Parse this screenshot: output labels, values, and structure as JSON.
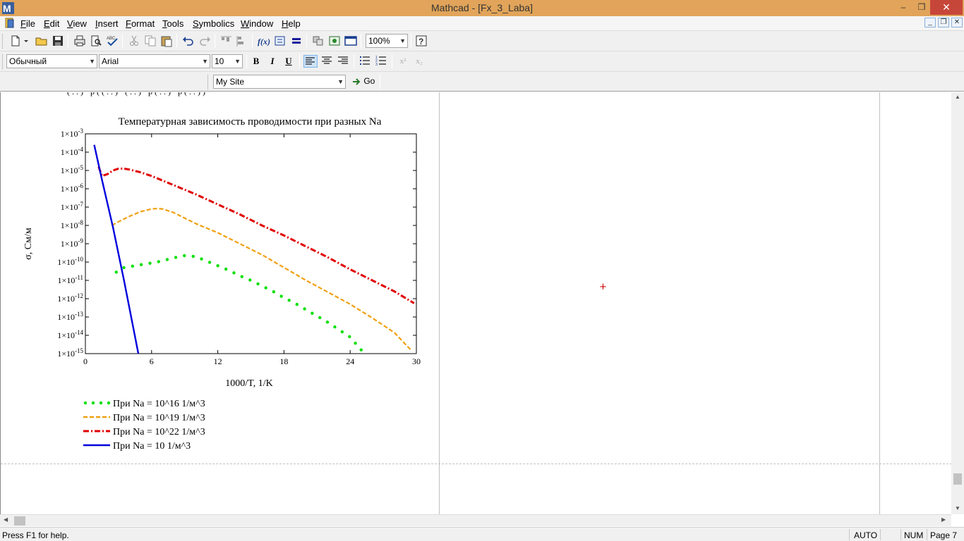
{
  "window": {
    "title": "Mathcad - [Fx_3_Laba]",
    "minimize_label": "–",
    "restore_label": "❐",
    "close_label": "✕"
  },
  "menu": {
    "items": [
      {
        "label": "File",
        "accel": "F",
        "rest": "ile"
      },
      {
        "label": "Edit",
        "accel": "E",
        "rest": "dit"
      },
      {
        "label": "View",
        "accel": "V",
        "rest": "iew"
      },
      {
        "label": "Insert",
        "accel": "I",
        "rest": "nsert"
      },
      {
        "label": "Format",
        "accel": "F",
        "rest": "ormat"
      },
      {
        "label": "Tools",
        "accel": "T",
        "rest": "ools"
      },
      {
        "label": "Symbolics",
        "accel": "S",
        "rest": "ymbolics"
      },
      {
        "label": "Window",
        "accel": "W",
        "rest": "indow"
      },
      {
        "label": "Help",
        "accel": "H",
        "rest": "elp"
      }
    ]
  },
  "toolbar": {
    "zoom_value": "100%",
    "style_value": "Обычный",
    "font_value": "Arial",
    "size_value": "10",
    "bold_label": "B",
    "italic_label": "I",
    "underline_label": "U",
    "site_value": "My Site",
    "go_label": "Go"
  },
  "status": {
    "help_text": "Press F1 for help.",
    "mode": "AUTO",
    "numlock": "NUM",
    "page": "Page 7"
  },
  "colors": {
    "titlebar": "#e1a45a",
    "close_button": "#c7463a",
    "series_16": "#00e000",
    "series_19": "#f0a010",
    "series_22": "#e00000",
    "series_10": "#0000dd"
  },
  "chart_data": {
    "type": "line",
    "title": "Температурная зависимость проводимости при разных Na",
    "xlabel": "1000/T, 1/K",
    "ylabel": "σ, См/м",
    "xlim": [
      0,
      30
    ],
    "ylim_exp": [
      -15,
      -3
    ],
    "yscale": "log",
    "x_ticks": [
      "0",
      "6",
      "12",
      "18",
      "24",
      "30"
    ],
    "y_ticks": [
      {
        "base": "1×10",
        "exp": "-3"
      },
      {
        "base": "1×10",
        "exp": "-4"
      },
      {
        "base": "1×10",
        "exp": "-5"
      },
      {
        "base": "1×10",
        "exp": "-6"
      },
      {
        "base": "1×10",
        "exp": "-7"
      },
      {
        "base": "1×10",
        "exp": "-8"
      },
      {
        "base": "1×10",
        "exp": "-9"
      },
      {
        "base": "1×10",
        "exp": "-10"
      },
      {
        "base": "1×10",
        "exp": "-11"
      },
      {
        "base": "1×10",
        "exp": "-12"
      },
      {
        "base": "1×10",
        "exp": "-13"
      },
      {
        "base": "1×10",
        "exp": "-14"
      },
      {
        "base": "1×10",
        "exp": "-15"
      }
    ],
    "grid": false,
    "legend_position": "bottom-left",
    "series": [
      {
        "name": "При Na = 10^16 1/м^3",
        "style": "dotted",
        "color": "#00e000",
        "x": [
          2.8,
          3.5,
          4.5,
          5.5,
          6.5,
          7.5,
          8.5,
          9.0,
          10.0,
          11.0,
          12.0,
          13.0,
          14.0,
          15.0,
          16.0,
          17.0,
          18.0,
          19.0,
          20.0,
          21.0,
          22.0,
          23.0,
          24.0,
          25.0
        ],
        "log10y": [
          -10.55,
          -10.3,
          -10.2,
          -10.1,
          -10.0,
          -9.85,
          -9.7,
          -9.65,
          -9.7,
          -9.95,
          -10.2,
          -10.45,
          -10.75,
          -11.0,
          -11.3,
          -11.6,
          -11.95,
          -12.25,
          -12.6,
          -12.95,
          -13.3,
          -13.7,
          -14.1,
          -14.8
        ]
      },
      {
        "name": "При Na = 10^19 1/м^3",
        "style": "dashed",
        "color": "#f0a010",
        "x": [
          2.4,
          3.0,
          4.0,
          5.0,
          6.0,
          6.5,
          7.0,
          8.0,
          9.0,
          10.0,
          12.0,
          14.0,
          16.0,
          18.0,
          20.0,
          22.0,
          24.0,
          26.0,
          28.0,
          29.5
        ],
        "log10y": [
          -8.0,
          -7.8,
          -7.5,
          -7.25,
          -7.1,
          -7.08,
          -7.1,
          -7.3,
          -7.6,
          -7.9,
          -8.4,
          -9.0,
          -9.6,
          -10.3,
          -11.0,
          -11.65,
          -12.3,
          -13.05,
          -13.85,
          -14.8
        ]
      },
      {
        "name": "При Na = 10^22 1/м^3",
        "style": "dashdot",
        "color": "#e00000",
        "x": [
          1.2,
          1.5,
          2.0,
          2.5,
          3.0,
          3.5,
          4.0,
          5.0,
          6.0,
          7.0,
          8.0,
          10.0,
          12.0,
          14.0,
          16.0,
          18.0,
          20.0,
          22.0,
          24.0,
          26.0,
          28.0,
          29.8
        ],
        "log10y": [
          -4.8,
          -5.3,
          -5.2,
          -5.0,
          -4.9,
          -4.9,
          -4.95,
          -5.1,
          -5.3,
          -5.55,
          -5.8,
          -6.3,
          -6.85,
          -7.4,
          -8.0,
          -8.55,
          -9.15,
          -9.75,
          -10.4,
          -11.0,
          -11.6,
          -12.25
        ]
      },
      {
        "name": "При Na = 10 1/м^3",
        "style": "solid",
        "color": "#0000dd",
        "x": [
          0.8,
          1.5,
          2.5,
          3.5,
          4.8
        ],
        "log10y": [
          -3.6,
          -5.5,
          -8.1,
          -11.0,
          -15.0
        ]
      }
    ]
  }
}
